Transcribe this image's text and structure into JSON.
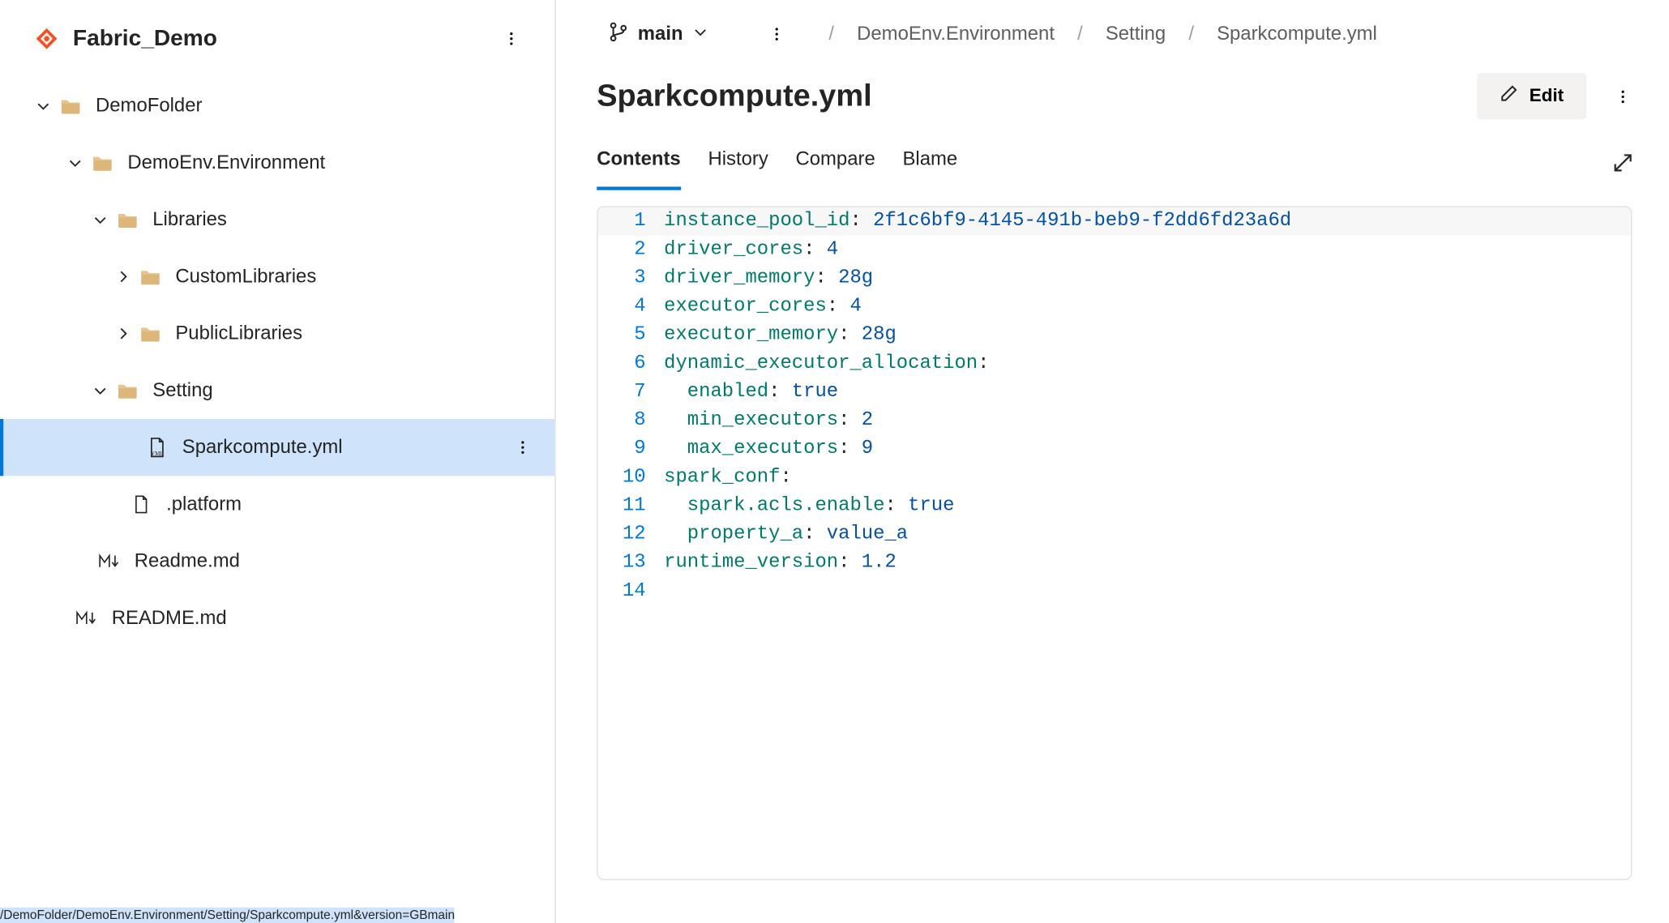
{
  "repo": {
    "name": "Fabric_Demo"
  },
  "tree": {
    "items": [
      {
        "label": "DemoFolder",
        "type": "folder",
        "indent": 30,
        "chevron": "down"
      },
      {
        "label": "DemoEnv.Environment",
        "type": "folder",
        "indent": 58,
        "chevron": "down"
      },
      {
        "label": "Libraries",
        "type": "folder",
        "indent": 80,
        "chevron": "down"
      },
      {
        "label": "CustomLibraries",
        "type": "folder",
        "indent": 100,
        "chevron": "right"
      },
      {
        "label": "PublicLibraries",
        "type": "folder",
        "indent": 100,
        "chevron": "right"
      },
      {
        "label": "Setting",
        "type": "folder",
        "indent": 80,
        "chevron": "down"
      },
      {
        "label": "Sparkcompute.yml",
        "type": "yml",
        "indent": 122,
        "chevron": "none",
        "selected": true
      },
      {
        "label": ".platform",
        "type": "file",
        "indent": 108,
        "chevron": "none"
      },
      {
        "label": "Readme.md",
        "type": "md",
        "indent": 80,
        "chevron": "none"
      },
      {
        "label": "README.md",
        "type": "md",
        "indent": 60,
        "chevron": "none"
      }
    ]
  },
  "branch": {
    "name": "main"
  },
  "breadcrumb": {
    "items": [
      {
        "label": "DemoEnv.Environment"
      },
      {
        "label": "Setting"
      },
      {
        "label": "Sparkcompute.yml"
      }
    ]
  },
  "file": {
    "title": "Sparkcompute.yml"
  },
  "buttons": {
    "edit": "Edit"
  },
  "tabs": {
    "items": [
      {
        "label": "Contents",
        "active": true
      },
      {
        "label": "History"
      },
      {
        "label": "Compare"
      },
      {
        "label": "Blame"
      }
    ]
  },
  "code": {
    "lines": [
      [
        {
          "t": "key",
          "v": "instance_pool_id"
        },
        {
          "t": "punc",
          "v": ": "
        },
        {
          "t": "str",
          "v": "2f1c6bf9-4145-491b-beb9-f2dd6fd23a6d"
        }
      ],
      [
        {
          "t": "key",
          "v": "driver_cores"
        },
        {
          "t": "punc",
          "v": ": "
        },
        {
          "t": "num",
          "v": "4"
        }
      ],
      [
        {
          "t": "key",
          "v": "driver_memory"
        },
        {
          "t": "punc",
          "v": ": "
        },
        {
          "t": "str",
          "v": "28g"
        }
      ],
      [
        {
          "t": "key",
          "v": "executor_cores"
        },
        {
          "t": "punc",
          "v": ": "
        },
        {
          "t": "num",
          "v": "4"
        }
      ],
      [
        {
          "t": "key",
          "v": "executor_memory"
        },
        {
          "t": "punc",
          "v": ": "
        },
        {
          "t": "str",
          "v": "28g"
        }
      ],
      [
        {
          "t": "key",
          "v": "dynamic_executor_allocation"
        },
        {
          "t": "punc",
          "v": ":"
        }
      ],
      [
        {
          "t": "punc",
          "v": "  "
        },
        {
          "t": "key",
          "v": "enabled"
        },
        {
          "t": "punc",
          "v": ": "
        },
        {
          "t": "bool",
          "v": "true"
        }
      ],
      [
        {
          "t": "punc",
          "v": "  "
        },
        {
          "t": "key",
          "v": "min_executors"
        },
        {
          "t": "punc",
          "v": ": "
        },
        {
          "t": "num",
          "v": "2"
        }
      ],
      [
        {
          "t": "punc",
          "v": "  "
        },
        {
          "t": "key",
          "v": "max_executors"
        },
        {
          "t": "punc",
          "v": ": "
        },
        {
          "t": "num",
          "v": "9"
        }
      ],
      [
        {
          "t": "key",
          "v": "spark_conf"
        },
        {
          "t": "punc",
          "v": ":"
        }
      ],
      [
        {
          "t": "punc",
          "v": "  "
        },
        {
          "t": "key",
          "v": "spark.acls.enable"
        },
        {
          "t": "punc",
          "v": ": "
        },
        {
          "t": "bool",
          "v": "true"
        }
      ],
      [
        {
          "t": "punc",
          "v": "  "
        },
        {
          "t": "key",
          "v": "property_a"
        },
        {
          "t": "punc",
          "v": ": "
        },
        {
          "t": "str",
          "v": "value_a"
        }
      ],
      [
        {
          "t": "key",
          "v": "runtime_version"
        },
        {
          "t": "punc",
          "v": ": "
        },
        {
          "t": "num",
          "v": "1.2"
        }
      ],
      []
    ]
  },
  "status_bar": "/DemoFolder/DemoEnv.Environment/Setting/Sparkcompute.yml&version=GBmain"
}
